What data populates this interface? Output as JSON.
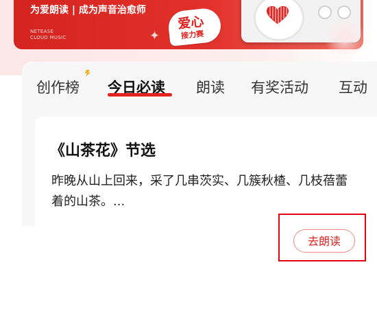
{
  "banner": {
    "slogan": "为爱朗读 | 成为声音治愈师",
    "brand_line1": "NETEASE",
    "brand_line2": "CLOUD MUSIC",
    "badge_line1": "爱心",
    "badge_line2": "接力赛"
  },
  "tabs": [
    {
      "label": "创作榜",
      "active": false
    },
    {
      "label": "今日必读",
      "active": true
    },
    {
      "label": "朗读",
      "active": false
    },
    {
      "label": "有奖活动",
      "active": false
    },
    {
      "label": "互动",
      "active": false
    }
  ],
  "card": {
    "title": "《山茶花》节选",
    "excerpt": "昨晚从山上回来，采了几串茨实、几簇秋楂、几枝蓓蕾着的山茶。..."
  },
  "read_button": {
    "label": "去朗读"
  },
  "colors": {
    "accent": "#e2231f",
    "highlight": "#e3000f",
    "spark": "#f5b323"
  }
}
